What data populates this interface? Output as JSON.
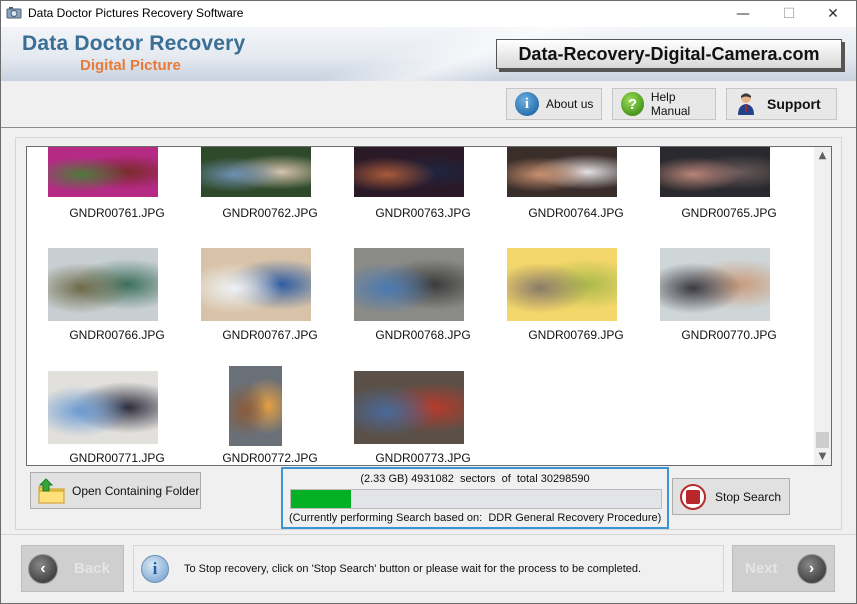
{
  "window": {
    "title": "Data Doctor Pictures Recovery Software",
    "controls": {
      "minimize": "—",
      "maximize": "☐",
      "close": "✕"
    }
  },
  "banner": {
    "brand": "Data Doctor Recovery",
    "subtitle": "Digital Picture",
    "website": "Data-Recovery-Digital-Camera.com"
  },
  "toolbar": {
    "about_label": "About us",
    "about_icon": "i",
    "help_label": "Help Manual",
    "help_icon": "?",
    "support_label": "Support"
  },
  "gallery": {
    "items": [
      {
        "label": "GNDR00761.JPG",
        "colors": [
          "#b52a85",
          "#4e7a3a",
          "#7a2a2a"
        ]
      },
      {
        "label": "GNDR00762.JPG",
        "colors": [
          "#2f4a2a",
          "#6e8fb2",
          "#d9c4b0"
        ]
      },
      {
        "label": "GNDR00763.JPG",
        "colors": [
          "#2a1a28",
          "#a85a3a",
          "#1e2440"
        ]
      },
      {
        "label": "GNDR00764.JPG",
        "colors": [
          "#3a2e2a",
          "#c98f6e",
          "#e6e2e8"
        ]
      },
      {
        "label": "GNDR00765.JPG",
        "colors": [
          "#2a2a2e",
          "#b98478",
          "#6a5a5a"
        ]
      },
      {
        "label": "GNDR00766.JPG",
        "colors": [
          "#c8cfd2",
          "#6e6a4a",
          "#3a6e5a"
        ]
      },
      {
        "label": "GNDR00767.JPG",
        "colors": [
          "#d8c3a8",
          "#eef2f5",
          "#2a5aa2"
        ]
      },
      {
        "label": "GNDR00768.JPG",
        "colors": [
          "#8a8a86",
          "#4a7ab2",
          "#3a3a3a"
        ]
      },
      {
        "label": "GNDR00769.JPG",
        "colors": [
          "#f4d76a",
          "#8a7a6a",
          "#a8b84a"
        ]
      },
      {
        "label": "GNDR00770.JPG",
        "colors": [
          "#cfd6d8",
          "#3a3a42",
          "#c99a7a"
        ]
      },
      {
        "label": "GNDR00771.JPG",
        "colors": [
          "#e2e0dc",
          "#6a9ad2",
          "#2a2a3a"
        ]
      },
      {
        "label": "GNDR00772.JPG",
        "colors": [
          "#6a7078",
          "#8a5a3a",
          "#e8a040"
        ]
      },
      {
        "label": "GNDR00773.JPG",
        "colors": [
          "#5a5048",
          "#4a6a9a",
          "#b83a2a"
        ]
      }
    ]
  },
  "actions": {
    "open_folder_label": "Open Containing Folder",
    "stop_label": "Stop Search"
  },
  "progress": {
    "size_text": "(2.33 GB)",
    "sectors_done": "4931082",
    "sectors_total": "30298590",
    "status_line": "(2.33 GB) 4931082  sectors  of  total 30298590",
    "procedure_line": "(Currently performing Search based on:  DDR General Recovery Procedure)",
    "fraction": 0.163
  },
  "footer": {
    "back_label": "Back",
    "next_label": "Next",
    "info_text": "To Stop recovery, click on 'Stop Search' button or please wait for the process to be completed."
  }
}
